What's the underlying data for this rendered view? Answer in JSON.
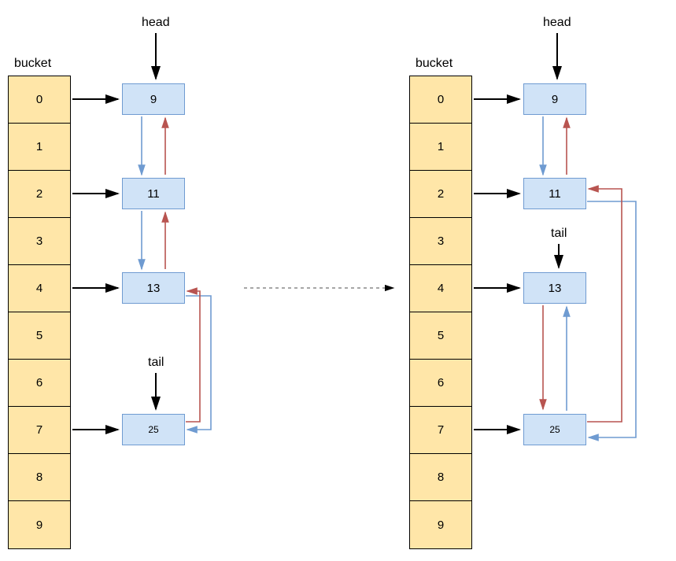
{
  "chart_data": {
    "type": "diagram",
    "description": "Linked-hash-map before and after moving node 25 in LRU order",
    "buckets": [
      0,
      1,
      2,
      3,
      4,
      5,
      6,
      7,
      8,
      9
    ],
    "left": {
      "head_label": "head",
      "bucket_label": "bucket",
      "tail_label": "tail",
      "nodes": [
        {
          "value": 9,
          "bucket": 0
        },
        {
          "value": 11,
          "bucket": 2
        },
        {
          "value": 13,
          "bucket": 4
        },
        {
          "value": 25,
          "bucket": 7
        }
      ],
      "order": [
        9,
        11,
        13,
        25
      ]
    },
    "right": {
      "head_label": "head",
      "bucket_label": "bucket",
      "tail_label": "tail",
      "nodes": [
        {
          "value": 9,
          "bucket": 0
        },
        {
          "value": 11,
          "bucket": 2
        },
        {
          "value": 13,
          "bucket": 4
        },
        {
          "value": 25,
          "bucket": 7
        }
      ],
      "order": [
        9,
        11,
        25,
        13
      ]
    }
  }
}
